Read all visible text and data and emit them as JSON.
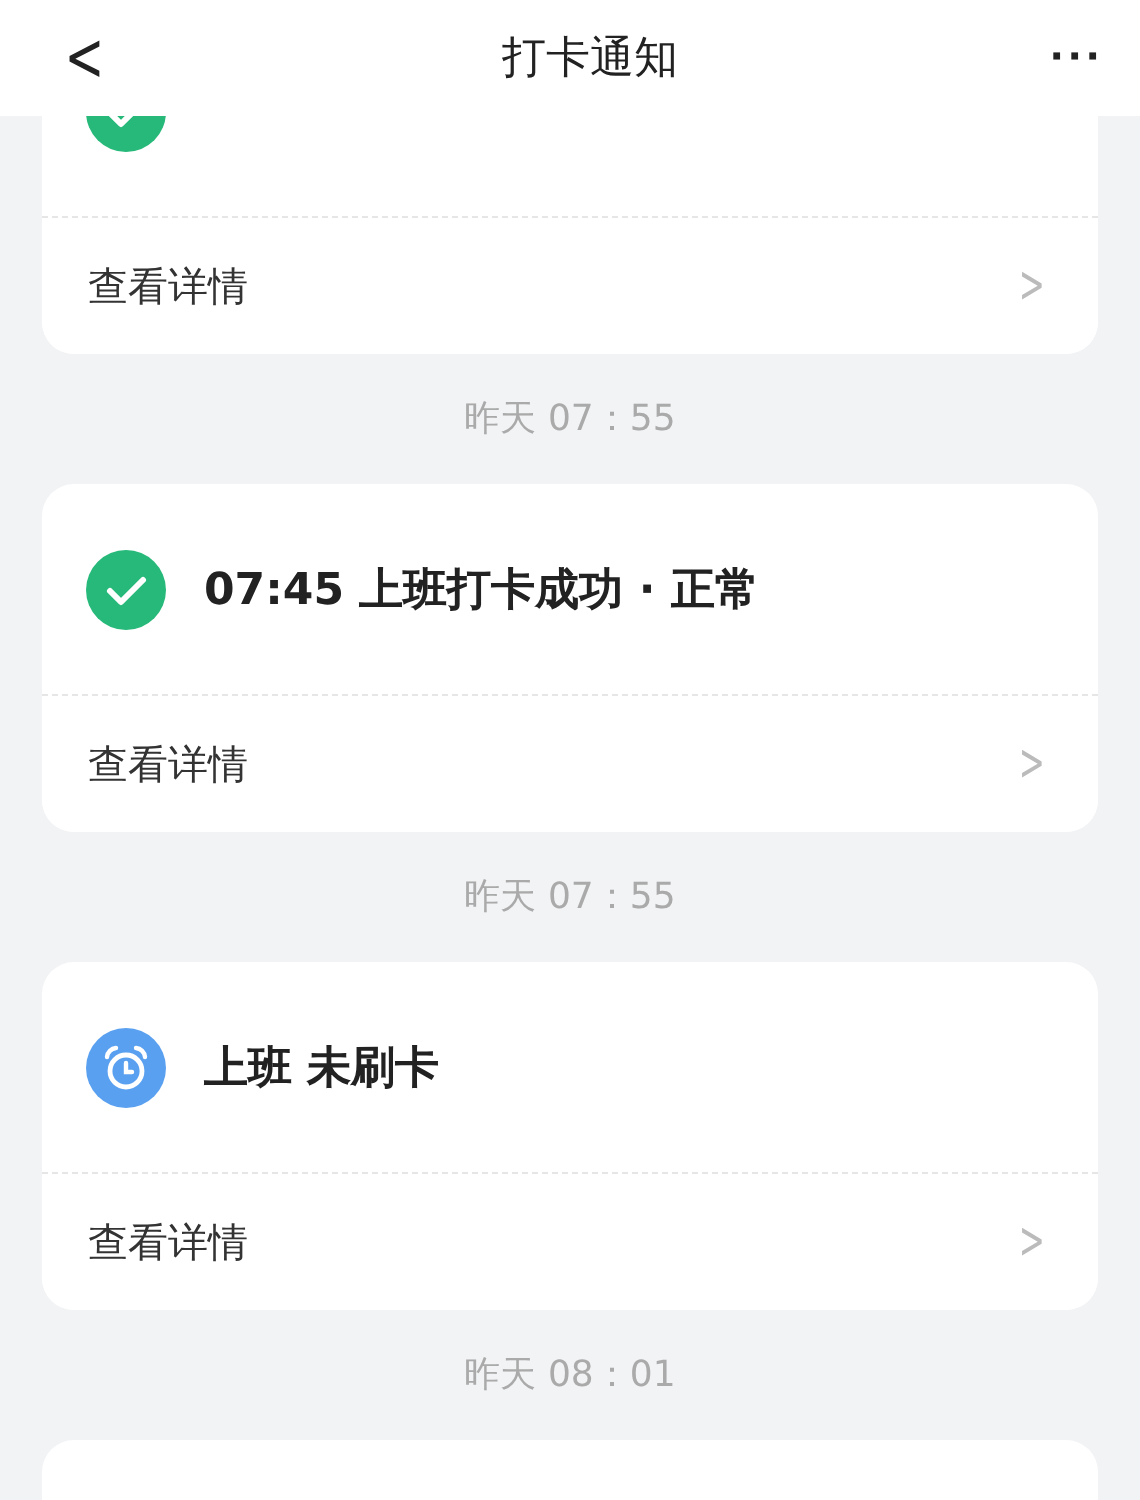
{
  "header": {
    "back": "<",
    "title": "打卡通知",
    "more": "···"
  },
  "feed": [
    {
      "kind": "success",
      "detail": "查看详情",
      "chevron": ">"
    },
    {
      "kind": "time",
      "text": "昨天 07：55"
    },
    {
      "kind": "success",
      "title": "07:45 上班打卡成功 · 正常",
      "detail": "查看详情",
      "chevron": ">"
    },
    {
      "kind": "time",
      "text": "昨天 07：55"
    },
    {
      "kind": "missed",
      "title": "上班 未刷卡",
      "detail": "查看详情",
      "chevron": ">"
    },
    {
      "kind": "time",
      "text": "昨天 08：01"
    },
    {
      "kind": "card_edge"
    }
  ]
}
